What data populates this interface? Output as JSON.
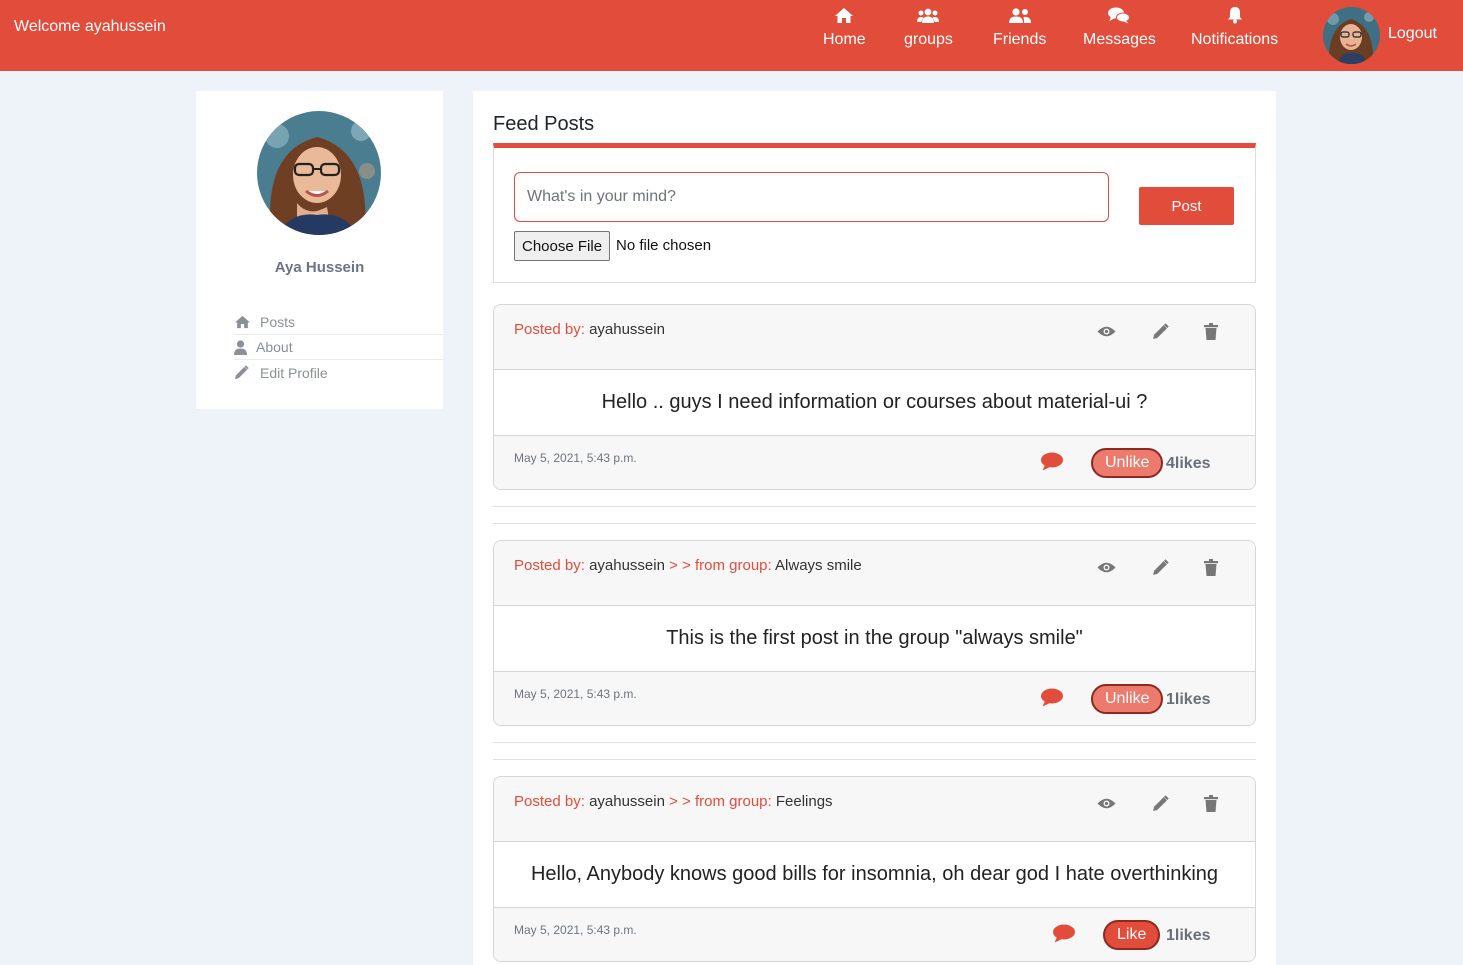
{
  "navbar": {
    "welcome": "Welcome ayahussein",
    "items": [
      {
        "label": "Home",
        "icon": "home-icon"
      },
      {
        "label": "groups",
        "icon": "users-icon"
      },
      {
        "label": "Friends",
        "icon": "user-friends-icon"
      },
      {
        "label": "Messages",
        "icon": "comments-icon"
      },
      {
        "label": "Notifications",
        "icon": "bell-icon"
      }
    ],
    "logout": "Logout"
  },
  "sidebar": {
    "name": "Aya Hussein",
    "menu": [
      {
        "label": "Posts",
        "icon": "home-icon"
      },
      {
        "label": "About",
        "icon": "user-icon"
      },
      {
        "label": "Edit Profile",
        "icon": "pencil-icon"
      }
    ]
  },
  "feed": {
    "title": "Feed Posts",
    "composer": {
      "placeholder": "What's in your mind?",
      "post_label": "Post",
      "file_button": "Choose File",
      "file_status": "No file chosen"
    },
    "posts_prefix": "Posted by:",
    "group_prefix": "> > from group:",
    "posts": [
      {
        "author": "ayahussein",
        "group": "",
        "content": "Hello .. guys I need information or courses about material-ui ?",
        "date": "May 5, 2021, 5:43 p.m.",
        "like_label": "Unlike",
        "likes": "4likes"
      },
      {
        "author": "ayahussein",
        "group": "Always smile",
        "content": "This is the first post in the group \"always smile\"",
        "date": "May 5, 2021, 5:43 p.m.",
        "like_label": "Unlike",
        "likes": "1likes"
      },
      {
        "author": "ayahussein",
        "group": "Feelings",
        "content": "Hello, Anybody knows good bills for insomnia, oh dear god I hate overthinking",
        "date": "May 5, 2021, 5:43 p.m.",
        "like_label": "Like",
        "likes": "1likes"
      }
    ]
  },
  "colors": {
    "accent": "#e24c3b",
    "background": "#eef2f9",
    "unlike_button": "#ec7b6d"
  }
}
